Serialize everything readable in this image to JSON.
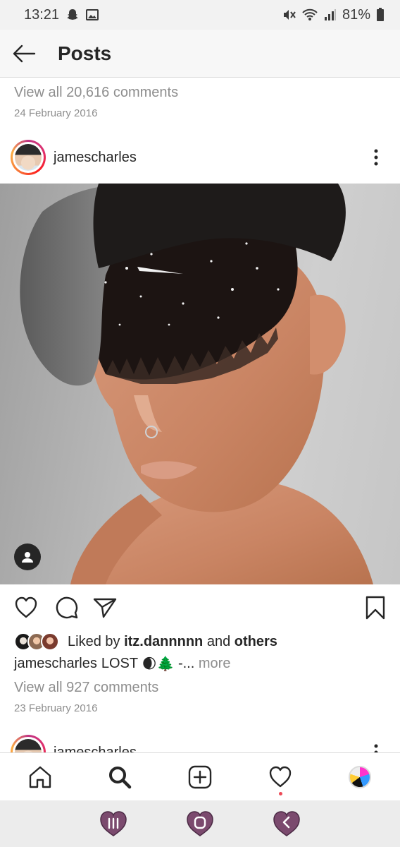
{
  "status_bar": {
    "time": "13:21",
    "battery": "81%",
    "left_icons": [
      "snapchat-icon",
      "image-icon"
    ],
    "right_icons": [
      "mute-icon",
      "wifi-icon",
      "signal-icon",
      "battery-icon"
    ]
  },
  "header": {
    "title": "Posts"
  },
  "previous_post": {
    "comments_link": "View all 20,616 comments",
    "date": "24 February 2016"
  },
  "post": {
    "username": "jamescharles",
    "liked_prefix": "Liked by",
    "liked_user": "itz.dannnnn",
    "liked_and": "and",
    "liked_others": "others",
    "caption_user": "jamescharles",
    "caption_text": "LOST",
    "caption_emoji": "🌒🌲",
    "caption_suffix": "-...",
    "caption_more": "more",
    "comments_link": "View all 927 comments",
    "date": "23 February 2016"
  },
  "next_post": {
    "username": "jamescharles"
  },
  "bottom_nav": {
    "items": [
      "home-icon",
      "search-icon",
      "new-post-icon",
      "activity-icon",
      "profile-avatar"
    ],
    "active": "search-icon"
  },
  "colors": {
    "accent_red": "#ed4956",
    "text_primary": "#262626",
    "text_secondary": "#8e8e8e",
    "system_nav_button": "#7b4a6e"
  }
}
